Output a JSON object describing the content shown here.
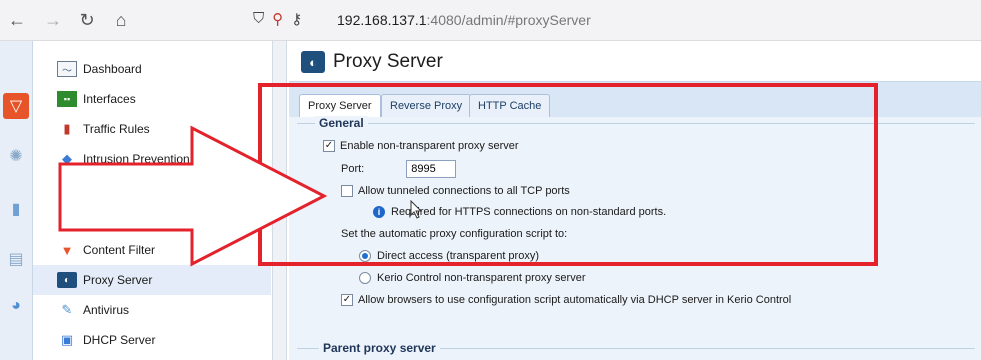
{
  "browser": {
    "url_host": "192.168.137.1",
    "url_rest": ":4080/admin/#proxyServer",
    "icons": [
      "back-icon",
      "forward-icon",
      "reload-icon",
      "home-icon",
      "shield-icon",
      "permissions-icon",
      "key-icon"
    ]
  },
  "sidebar": {
    "items": [
      {
        "label": "Dashboard",
        "icon": "dashboard-icon"
      },
      {
        "label": "Interfaces",
        "icon": "interfaces-icon"
      },
      {
        "label": "Traffic Rules",
        "icon": "traffic-rules-icon"
      },
      {
        "label": "Intrusion Prevention",
        "icon": "intrusion-prevention-icon"
      },
      {
        "label": "Content Filter",
        "icon": "content-filter-icon"
      },
      {
        "label": "Proxy Server",
        "icon": "proxy-server-icon"
      },
      {
        "label": "Antivirus",
        "icon": "antivirus-icon"
      },
      {
        "label": "DHCP Server",
        "icon": "dhcp-server-icon"
      }
    ]
  },
  "main": {
    "title": "Proxy Server",
    "tabs": [
      "Proxy Server",
      "Reverse Proxy",
      "HTTP Cache"
    ],
    "active_tab": 0,
    "general": {
      "title": "General",
      "enable_label": "Enable non-transparent proxy server",
      "enable_checked": true,
      "port_label": "Port:",
      "port_value": "8995",
      "tunnel_label": "Allow tunneled connections to all TCP ports",
      "tunnel_checked": false,
      "info_text": "Required for HTTPS connections on non-standard ports.",
      "script_label": "Set the automatic proxy configuration script to:",
      "radio_direct": "Direct access (transparent proxy)",
      "radio_kerio": "Kerio Control non-transparent proxy server",
      "selected_radio": "direct",
      "dhcp_label": "Allow browsers to use configuration script automatically via DHCP server in Kerio Control",
      "dhcp_checked": true
    },
    "parent_title": "Parent proxy server"
  },
  "colors": {
    "highlight": "#e3222b",
    "accent": "#1f66c9"
  }
}
